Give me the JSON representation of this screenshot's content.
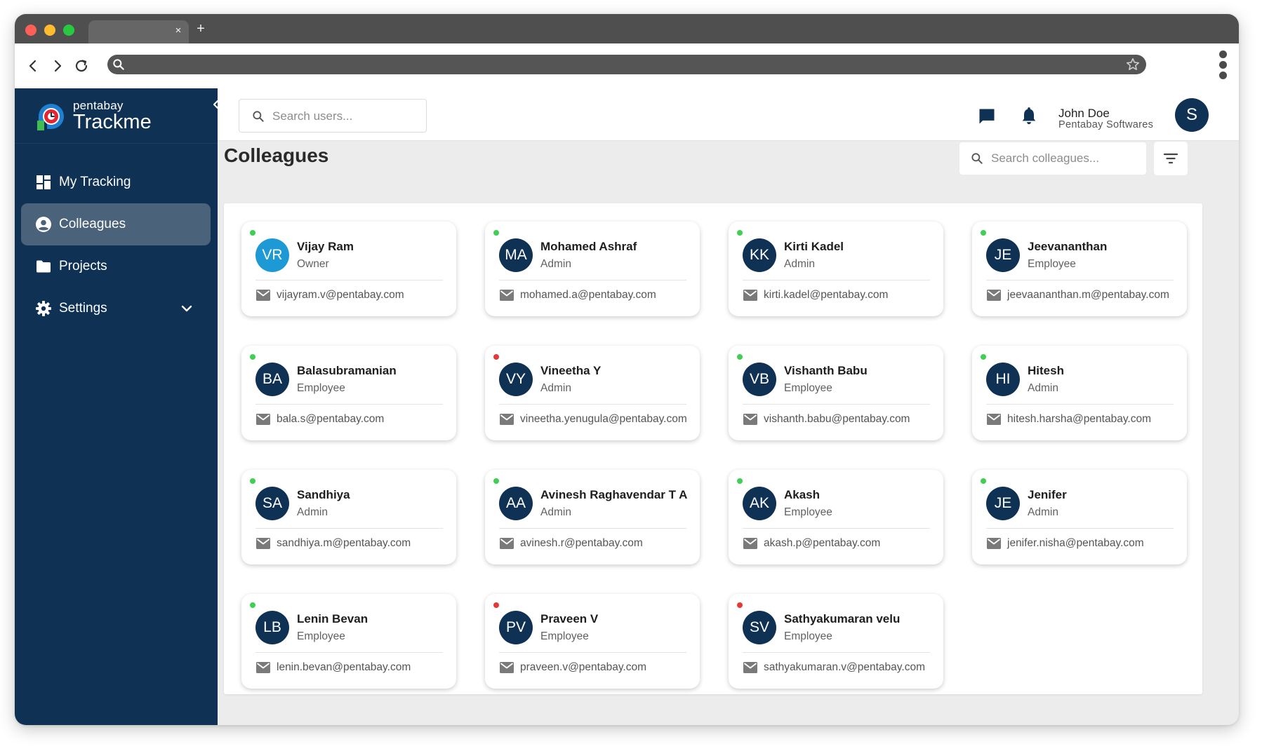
{
  "browser": {
    "tab_close": "×",
    "tab_new": "+"
  },
  "sidebar": {
    "brand_small": "pentabay",
    "brand_big": "Trackme",
    "items": [
      {
        "label": "My Tracking",
        "icon": "dashboard-icon"
      },
      {
        "label": "Colleagues",
        "icon": "account-circle-icon",
        "active": true
      },
      {
        "label": "Projects",
        "icon": "folder-icon"
      },
      {
        "label": "Settings",
        "icon": "gear-icon",
        "expandable": true
      }
    ]
  },
  "header": {
    "search_placeholder": "Search users...",
    "user_name": "John Doe",
    "user_company": "Pentabay Softwares",
    "avatar_initial": "S"
  },
  "main": {
    "title": "Colleagues",
    "search_placeholder": "Search colleagues..."
  },
  "colors": {
    "sidebar_bg": "#0f3154",
    "active_item_bg": "#4a627a",
    "accent_avatar": "#1d9ad6",
    "online": "#3fcf52",
    "offline": "#e53935"
  },
  "colleagues": [
    {
      "initials": "VR",
      "name": "Vijay Ram",
      "role": "Owner",
      "email": "vijayram.v@pentabay.com",
      "status": "online",
      "accent": true
    },
    {
      "initials": "MA",
      "name": "Mohamed Ashraf",
      "role": "Admin",
      "email": "mohamed.a@pentabay.com",
      "status": "online"
    },
    {
      "initials": "KK",
      "name": "Kirti Kadel",
      "role": "Admin",
      "email": "kirti.kadel@pentabay.com",
      "status": "online"
    },
    {
      "initials": "JE",
      "name": "Jeevananthan",
      "role": "Employee",
      "email": "jeevaananthan.m@pentabay.com",
      "status": "online"
    },
    {
      "initials": "BA",
      "name": "Balasubramanian",
      "role": "Employee",
      "email": "bala.s@pentabay.com",
      "status": "online"
    },
    {
      "initials": "VY",
      "name": "Vineetha Y",
      "role": "Admin",
      "email": "vineetha.yenugula@pentabay.com",
      "status": "offline"
    },
    {
      "initials": "VB",
      "name": "Vishanth Babu",
      "role": "Employee",
      "email": "vishanth.babu@pentabay.com",
      "status": "online"
    },
    {
      "initials": "HI",
      "name": "Hitesh",
      "role": "Admin",
      "email": "hitesh.harsha@pentabay.com",
      "status": "online"
    },
    {
      "initials": "SA",
      "name": "Sandhiya",
      "role": "Admin",
      "email": "sandhiya.m@pentabay.com",
      "status": "online"
    },
    {
      "initials": "AA",
      "name": "Avinesh Raghavendar T A",
      "role": "Admin",
      "email": "avinesh.r@pentabay.com",
      "status": "online"
    },
    {
      "initials": "AK",
      "name": "Akash",
      "role": "Employee",
      "email": "akash.p@pentabay.com",
      "status": "online"
    },
    {
      "initials": "JE",
      "name": "Jenifer",
      "role": "Admin",
      "email": "jenifer.nisha@pentabay.com",
      "status": "online"
    },
    {
      "initials": "LB",
      "name": "Lenin Bevan",
      "role": "Employee",
      "email": "lenin.bevan@pentabay.com",
      "status": "online"
    },
    {
      "initials": "PV",
      "name": "Praveen V",
      "role": "Employee",
      "email": "praveen.v@pentabay.com",
      "status": "offline"
    },
    {
      "initials": "SV",
      "name": "Sathyakumaran velu",
      "role": "Employee",
      "email": "sathyakumaran.v@pentabay.com",
      "status": "offline"
    }
  ]
}
